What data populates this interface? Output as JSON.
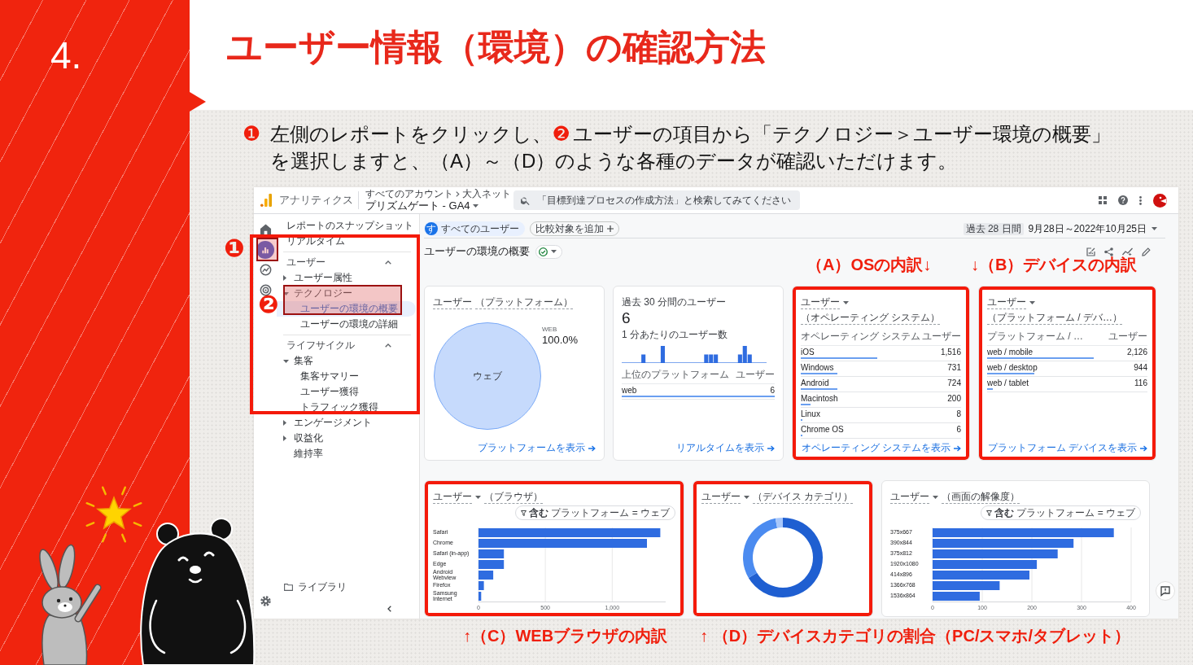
{
  "slide": {
    "number": "4.",
    "title": "ユーザー情報（環境）の確認方法",
    "instruction": [
      {
        "marker": "❶",
        "text": "左側のレポートをクリックし、"
      },
      {
        "marker": "❷",
        "text": "ユーザーの項目から「テクノロジー＞ユーザー環境の概要」を選択しますと、（A）～（D）のような各種のデータが確認いただけます。"
      }
    ]
  },
  "app": {
    "header": {
      "product": "アナリティクス",
      "breadcrumb": [
        "すべてのアカウント",
        "大入ネット"
      ],
      "property": "プリズムゲート - GA4",
      "search": {
        "placeholder": "「目標到達プロセスの作成方法」と検索してみてください"
      }
    },
    "rail": [
      {
        "selected": false
      },
      {
        "selected": true
      },
      {
        "selected": false
      },
      {
        "selected": false
      }
    ],
    "nav": {
      "items": [
        {
          "kind": "link",
          "label": "レポートのスナップショット",
          "selected": false
        },
        {
          "kind": "link",
          "label": "リアルタイム",
          "selected": false
        },
        {
          "kind": "section",
          "label": "ユーザー",
          "expanded": true,
          "children": [
            {
              "kind": "group",
              "label": "ユーザー属性",
              "expanded": false,
              "selected": false
            },
            {
              "kind": "group",
              "label": "テクノロジー",
              "expanded": true,
              "selected": false,
              "children": [
                {
                  "kind": "link",
                  "label": "ユーザーの環境の概要",
                  "selected": true
                },
                {
                  "kind": "link",
                  "label": "ユーザーの環境の詳細",
                  "selected": false
                }
              ]
            }
          ]
        },
        {
          "kind": "section",
          "label": "ライフサイクル",
          "expanded": true,
          "children": [
            {
              "kind": "group",
              "label": "集客",
              "expanded": true,
              "selected": false,
              "children": [
                {
                  "kind": "link",
                  "label": "集客サマリー",
                  "selected": false
                },
                {
                  "kind": "link",
                  "label": "ユーザー獲得",
                  "selected": false
                },
                {
                  "kind": "link",
                  "label": "トラフィック獲得",
                  "selected": false
                }
              ]
            },
            {
              "kind": "group",
              "label": "エンゲージメント",
              "expanded": false,
              "selected": false
            },
            {
              "kind": "group",
              "label": "収益化",
              "expanded": false,
              "selected": false
            },
            {
              "kind": "link",
              "label": "維持率",
              "selected": false
            }
          ]
        }
      ],
      "library": "ライブラリ"
    },
    "main": {
      "segment": {
        "initial": "す",
        "label": "すべてのユーザー"
      },
      "compare": "比較対象を追加",
      "date": {
        "period": "過去 28 日間",
        "range": "9月28日～2022年10月25日"
      },
      "title": "ユーザーの環境の概要",
      "cards": [
        {
          "kind": "pie",
          "metric": "ユーザー",
          "metric_menu": false,
          "dimension": "（プラットフォーム）",
          "legend": {
            "label": "WEB",
            "value": "100.0%"
          },
          "chart_data": {
            "type": "pie",
            "categories": [
              "ウェブ"
            ],
            "values": [
              100
            ]
          },
          "link": "プラットフォームを表示",
          "highlighted": false
        },
        {
          "kind": "realtime",
          "title": "過去 30 分間のユーザー",
          "value": "6",
          "subtitle": "1 分あたりのユーザー数",
          "table": {
            "columns": [
              "上位のプラットフォーム",
              "ユーザー"
            ],
            "rows": [
              {
                "name": "web",
                "value": "6",
                "level": 1
              }
            ]
          },
          "link": "リアルタイムを表示",
          "highlighted": false
        },
        {
          "kind": "table",
          "metric": "ユーザー",
          "metric_menu": true,
          "dimension": "（オペレーティング システム）",
          "columns": [
            "オペレーティング システム",
            "ユーザー"
          ],
          "rows": [
            {
              "name": "iOS",
              "value": "1,516",
              "level": 0.476
            },
            {
              "name": "Windows",
              "value": "731",
              "level": 0.23
            },
            {
              "name": "Android",
              "value": "724",
              "level": 0.227
            },
            {
              "name": "Macintosh",
              "value": "200",
              "level": 0.063
            },
            {
              "name": "Linux",
              "value": "8",
              "level": 0.003
            },
            {
              "name": "Chrome OS",
              "value": "6",
              "level": 0.002
            }
          ],
          "link": "オペレーティング システムを表示",
          "highlighted": true
        },
        {
          "kind": "table",
          "metric": "ユーザー",
          "metric_menu": true,
          "dimension": "（プラットフォーム / デバ…）",
          "columns": [
            "プラットフォーム / …",
            "ユーザー"
          ],
          "rows": [
            {
              "name": "web / mobile",
              "value": "2,126",
              "level": 0.667
            },
            {
              "name": "web / desktop",
              "value": "944",
              "level": 0.296
            },
            {
              "name": "web / tablet",
              "value": "116",
              "level": 0.036
            }
          ],
          "link": "プラットフォーム デバイスを表示",
          "highlighted": true
        },
        {
          "kind": "bar",
          "metric": "ユーザー",
          "metric_menu": true,
          "dimension": "（ブラウザ）",
          "filter": {
            "operator": "含む",
            "condition": "プラットフォーム = ウェブ"
          },
          "chart_data": {
            "type": "bar",
            "orientation": "horizontal",
            "categories": [
              "Safari",
              "Chrome",
              "Safari (in-app)",
              "Edge",
              "Android Webview",
              "Firefox",
              "Samsung Internet"
            ],
            "values": [
              1360,
              1260,
              190,
              190,
              110,
              40,
              20
            ],
            "xlim": [
              0,
              1400
            ],
            "xticks": [
              0,
              500,
              {
                "value": 1000,
                "label": "1,000"
              }
            ],
            "grid": true
          },
          "highlighted": true
        },
        {
          "kind": "donut",
          "metric": "ユーザー",
          "metric_menu": true,
          "dimension": "（デバイス カテゴリ）",
          "highlighted": true
        },
        {
          "kind": "bar",
          "metric": "ユーザー",
          "metric_menu": true,
          "dimension": "（画面の解像度）",
          "filter": {
            "operator": "含む",
            "condition": "プラットフォーム = ウェブ"
          },
          "chart_data": {
            "type": "bar",
            "orientation": "horizontal",
            "categories": [
              "375x667",
              "390x844",
              "375x812",
              "1920x1080",
              "414x896",
              "1366x768",
              "1536x864"
            ],
            "values": [
              365,
              284,
              252,
              210,
              195,
              135,
              95
            ],
            "xlim": [
              0,
              400
            ],
            "xticks": [
              0,
              100,
              200,
              300,
              400
            ],
            "grid": true
          },
          "highlighted": false
        }
      ]
    }
  },
  "annotations": {
    "markers": [
      "❶",
      "❷"
    ],
    "labels": [
      "（A）OSの内訳↓",
      "↓（B）デバイスの内訳",
      "↑（C）WEBブラウザの内訳",
      "↑ （D）デバイスカテゴリの割合（PC/スマホ/タブレット）"
    ]
  }
}
